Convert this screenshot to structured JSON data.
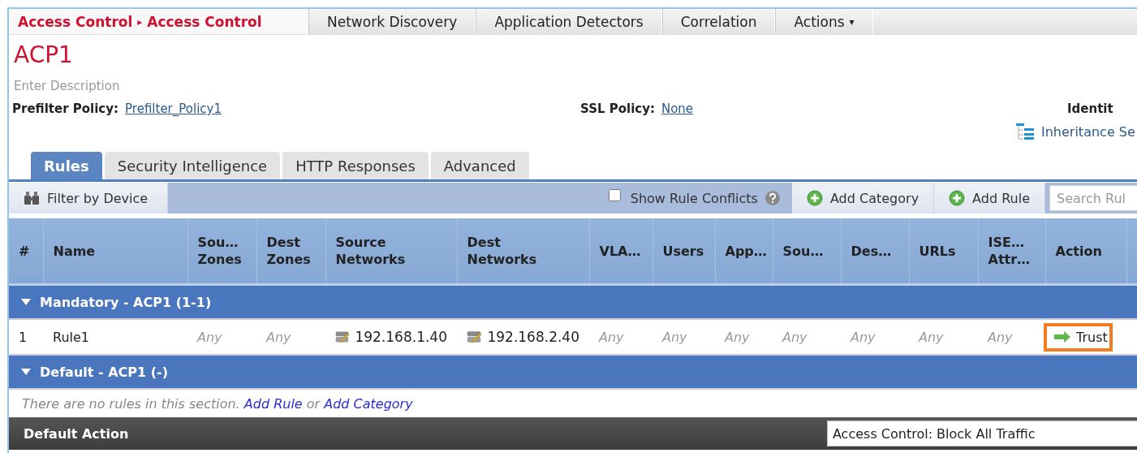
{
  "breadcrumb": {
    "parent": "Access Control",
    "separator": "▸",
    "current": "Access Control"
  },
  "top_nav": [
    {
      "label": "Network Discovery"
    },
    {
      "label": "Application Detectors"
    },
    {
      "label": "Correlation"
    },
    {
      "label": "Actions",
      "caret": "▾"
    }
  ],
  "policy": {
    "name": "ACP1",
    "description": "Enter Description"
  },
  "settings": [
    {
      "label": "Prefilter Policy:",
      "value": "Prefilter_Policy1"
    },
    {
      "label": "SSL Policy:",
      "value": "None"
    },
    {
      "label": "Identit"
    }
  ],
  "inheritance_link": "Inheritance Se",
  "tabs": [
    {
      "label": "Rules",
      "selected": true
    },
    {
      "label": "Security Intelligence",
      "selected": false
    },
    {
      "label": "HTTP Responses",
      "selected": false
    },
    {
      "label": "Advanced",
      "selected": false
    }
  ],
  "toolbar": {
    "filter_button": "Filter by Device",
    "show_conflicts": {
      "label": "Show Rule Conflicts",
      "checked": false
    },
    "buttons": [
      "Add Category",
      "Add Rule"
    ],
    "search": {
      "placeholder": "Search Rul"
    }
  },
  "table": {
    "columns": [
      "#",
      "Name",
      "Sou…\nZones",
      "Dest\nZones",
      "Source\nNetworks",
      "Dest\nNetworks",
      "VLA…",
      "Users",
      "App…",
      "Sou…",
      "Des…",
      "URLs",
      "ISE…\nAttr…",
      "Action"
    ],
    "sections": [
      {
        "title": "Mandatory - ACP1 (1-1)",
        "expanded": true,
        "rows": [
          {
            "cells": [
              {
                "kind": "number",
                "text": "1"
              },
              {
                "kind": "text",
                "text": "Rule1"
              },
              {
                "kind": "any",
                "text": "Any"
              },
              {
                "kind": "any",
                "text": "Any"
              },
              {
                "kind": "network",
                "text": "192.168.1.40"
              },
              {
                "kind": "network",
                "text": "192.168.2.40"
              },
              {
                "kind": "any",
                "text": "Any"
              },
              {
                "kind": "any",
                "text": "Any"
              },
              {
                "kind": "any",
                "text": "Any"
              },
              {
                "kind": "any",
                "text": "Any"
              },
              {
                "kind": "any",
                "text": "Any"
              },
              {
                "kind": "any",
                "text": "Any"
              },
              {
                "kind": "any",
                "text": "Any"
              },
              {
                "kind": "action",
                "text": "Trust",
                "highlighted": true
              }
            ]
          }
        ]
      },
      {
        "title": "Default - ACP1 (-)",
        "expanded": true,
        "empty_message": {
          "text": "There are no rules in this section.",
          "links": [
            "Add Rule",
            "Add Category"
          ],
          "joiner": "or"
        }
      }
    ]
  },
  "default_action": {
    "label": "Default Action",
    "value": "Access Control: Block All Traffic"
  }
}
